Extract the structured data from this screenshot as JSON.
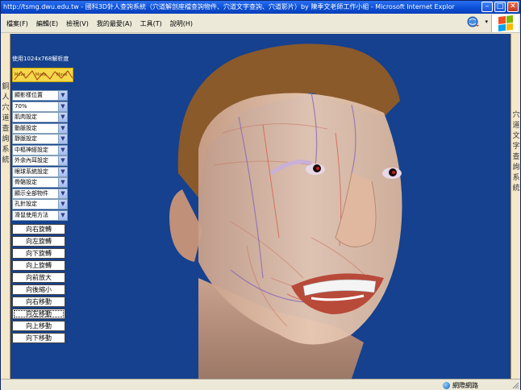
{
  "window": {
    "title": "http://tsmg.dwu.edu.tw - 國科3D針人查詢系統（穴道解剖座檔查詢物件、穴道文字查詢、穴道影片）by 陳季文老師工作小組 - Microsoft Internet Explorer"
  },
  "menu": {
    "items": [
      "檔案(F)",
      "編輯(E)",
      "檢視(V)",
      "我的最愛(A)",
      "工具(T)",
      "說明(H)"
    ]
  },
  "left_sidebar": {
    "label": "銅人穴道查詢系統"
  },
  "right_sidebar": {
    "label": "穴道文字查詢系統"
  },
  "panel": {
    "resolution_note": "使用1024x768解析度",
    "banner_words": [
      "Move",
      "Move",
      "Move"
    ],
    "selects": [
      "顯影樣位置",
      "70%",
      "肌肉設定",
      "動脈設定",
      "靜脈設定",
      "中樞神經設定",
      "外余內耳設定",
      "眼球系統設定",
      "骨骼設定",
      "顯示全部物件",
      "孔針設定",
      "滑鼠使用方法"
    ],
    "buttons": [
      "向右旋轉",
      "向左旋轉",
      "向下旋轉",
      "向上旋轉",
      "向前放大",
      "向後縮小",
      "向右移動",
      "向左移動",
      "向上移動",
      "向下移動"
    ],
    "focused_button_index": 7
  },
  "statusbar": {
    "zone": "網際網路"
  },
  "colors": {
    "viewport_bg": "#15418e",
    "titlebar": "#0b4fd6",
    "sidebar": "#f4e8c8",
    "banner": "#f2d84a"
  }
}
